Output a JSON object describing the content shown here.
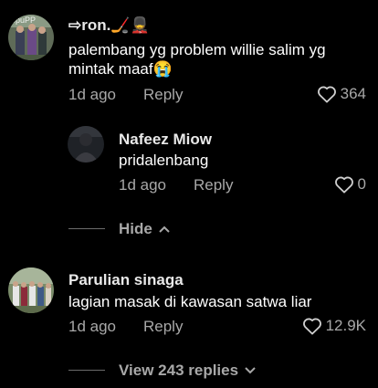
{
  "comments": [
    {
      "username": "⇨ron.🏒💂",
      "text_line1": "palembang yg problem willie salim yg",
      "text_line2": "mintak maaf😭",
      "time": "1d ago",
      "reply_label": "Reply",
      "likes": "364"
    },
    {
      "username": "Nafeez Miow",
      "text": "pridalenbang",
      "time": "1d ago",
      "reply_label": "Reply",
      "likes": "0"
    },
    {
      "username": "Parulian sinaga",
      "text": "lagian masak di kawasan satwa liar",
      "time": "1d ago",
      "reply_label": "Reply",
      "likes": "12.9K"
    }
  ],
  "hide_label": "Hide",
  "view_replies_label": "View 243 replies",
  "avatar1_label": "opuPP",
  "icons": [
    "heart-icon",
    "chevron-up-icon",
    "chevron-down-icon"
  ]
}
